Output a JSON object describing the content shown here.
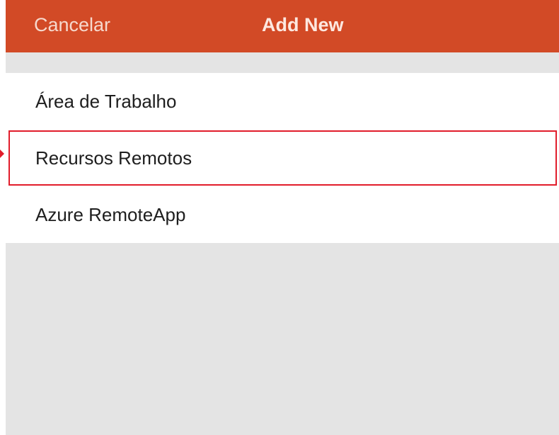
{
  "navbar": {
    "cancel_label": "Cancelar",
    "title": "Add New",
    "color": "#d24a26"
  },
  "list": {
    "items": [
      {
        "label": "Área de Trabalho"
      },
      {
        "label": "Recursos Remotos",
        "highlighted": true
      },
      {
        "label": "Azure RemoteApp"
      }
    ]
  },
  "colors": {
    "highlight": "#e11d2b",
    "background": "#e4e4e4"
  }
}
